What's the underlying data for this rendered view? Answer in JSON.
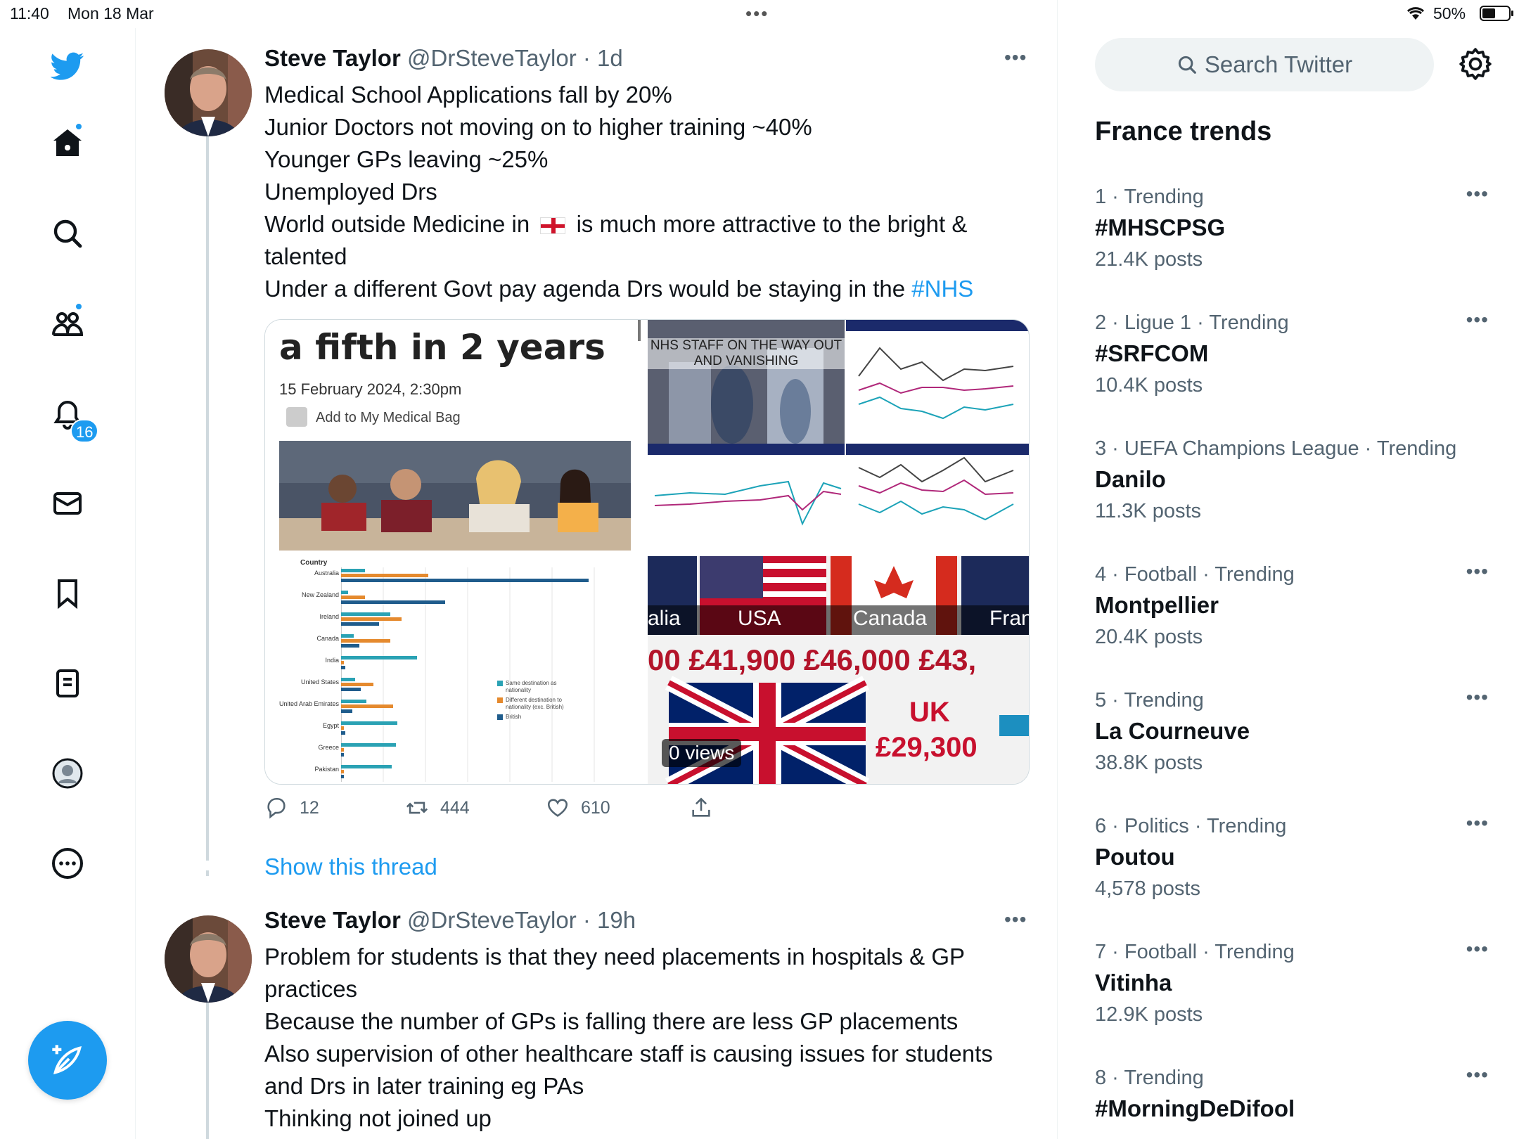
{
  "status_bar": {
    "time": "11:40",
    "date": "Mon 18 Mar",
    "battery": "50%"
  },
  "nav": {
    "notifications_count": "16"
  },
  "tweets": [
    {
      "name": "Steve Taylor",
      "handle": "@DrSteveTaylor",
      "time": "1d",
      "lines": [
        "Medical School Applications fall by 20%",
        "Junior Doctors not moving on to higher training ~40%",
        "Younger GPs leaving ~25%",
        "Unemployed Drs",
        "World outside Medicine in",
        "is much more attractive to the bright &",
        "talented",
        "Under a different Govt pay agenda Drs would be staying in the",
        "#NHS"
      ],
      "media": {
        "article_title": "a fifth in 2 years",
        "article_date": "15 February 2024, 2:30pm",
        "article_bag": "Add to My Medical Bag",
        "nhs_caption": "NHS STAFF ON THE WAY OUT AND VANISHING",
        "views": "0 views",
        "salary_countries": [
          "alia",
          "USA",
          "Canada",
          "Fran"
        ],
        "salary_values": "00 £41,900 £46,000 £43,",
        "uk_label": "UK",
        "uk_salary": "£29,300",
        "bar_chart": {
          "header": "Country",
          "countries": [
            "Australia",
            "New Zealand",
            "Ireland",
            "Canada",
            "India",
            "United States",
            "United Arab Emirates",
            "Egypt",
            "Greece",
            "Pakistan"
          ],
          "legend": [
            "Same destination as nationality",
            "Different destination to nationality (exc. British)",
            "British"
          ]
        }
      },
      "actions": {
        "replies": "12",
        "retweets": "444",
        "likes": "610"
      }
    },
    {
      "name": "Steve Taylor",
      "handle": "@DrSteveTaylor",
      "time": "19h",
      "lines": [
        "Problem for students is that they need placements in hospitals & GP",
        "practices",
        "Because the number of GPs is falling there are less GP placements",
        "Also supervision of other healthcare staff is causing issues for students",
        "and Drs in later training eg PAs",
        "Thinking not joined up"
      ]
    }
  ],
  "show_thread": "Show this thread",
  "search": {
    "placeholder": "Search Twitter"
  },
  "trends": {
    "title": "France trends",
    "items": [
      {
        "meta": "1 · Trending",
        "topic": "#MHSCPSG",
        "posts": "21.4K posts"
      },
      {
        "meta": "2 · Ligue 1 · Trending",
        "topic": "#SRFCOM",
        "posts": "10.4K posts"
      },
      {
        "meta": "3 · UEFA Champions League · Trending",
        "topic": "Danilo",
        "posts": "11.3K posts"
      },
      {
        "meta": "4 · Football · Trending",
        "topic": "Montpellier",
        "posts": "20.4K posts"
      },
      {
        "meta": "5 · Trending",
        "topic": "La Courneuve",
        "posts": "38.8K posts"
      },
      {
        "meta": "6 · Politics · Trending",
        "topic": "Poutou",
        "posts": "4,578 posts"
      },
      {
        "meta": "7 · Football · Trending",
        "topic": "Vitinha",
        "posts": "12.9K posts"
      },
      {
        "meta": "8 · Trending",
        "topic": "#MorningDeDifool",
        "posts": ""
      }
    ]
  },
  "colors": {
    "accent": "#1d9bf0",
    "text": "#0f1419",
    "secondary": "#536471"
  }
}
